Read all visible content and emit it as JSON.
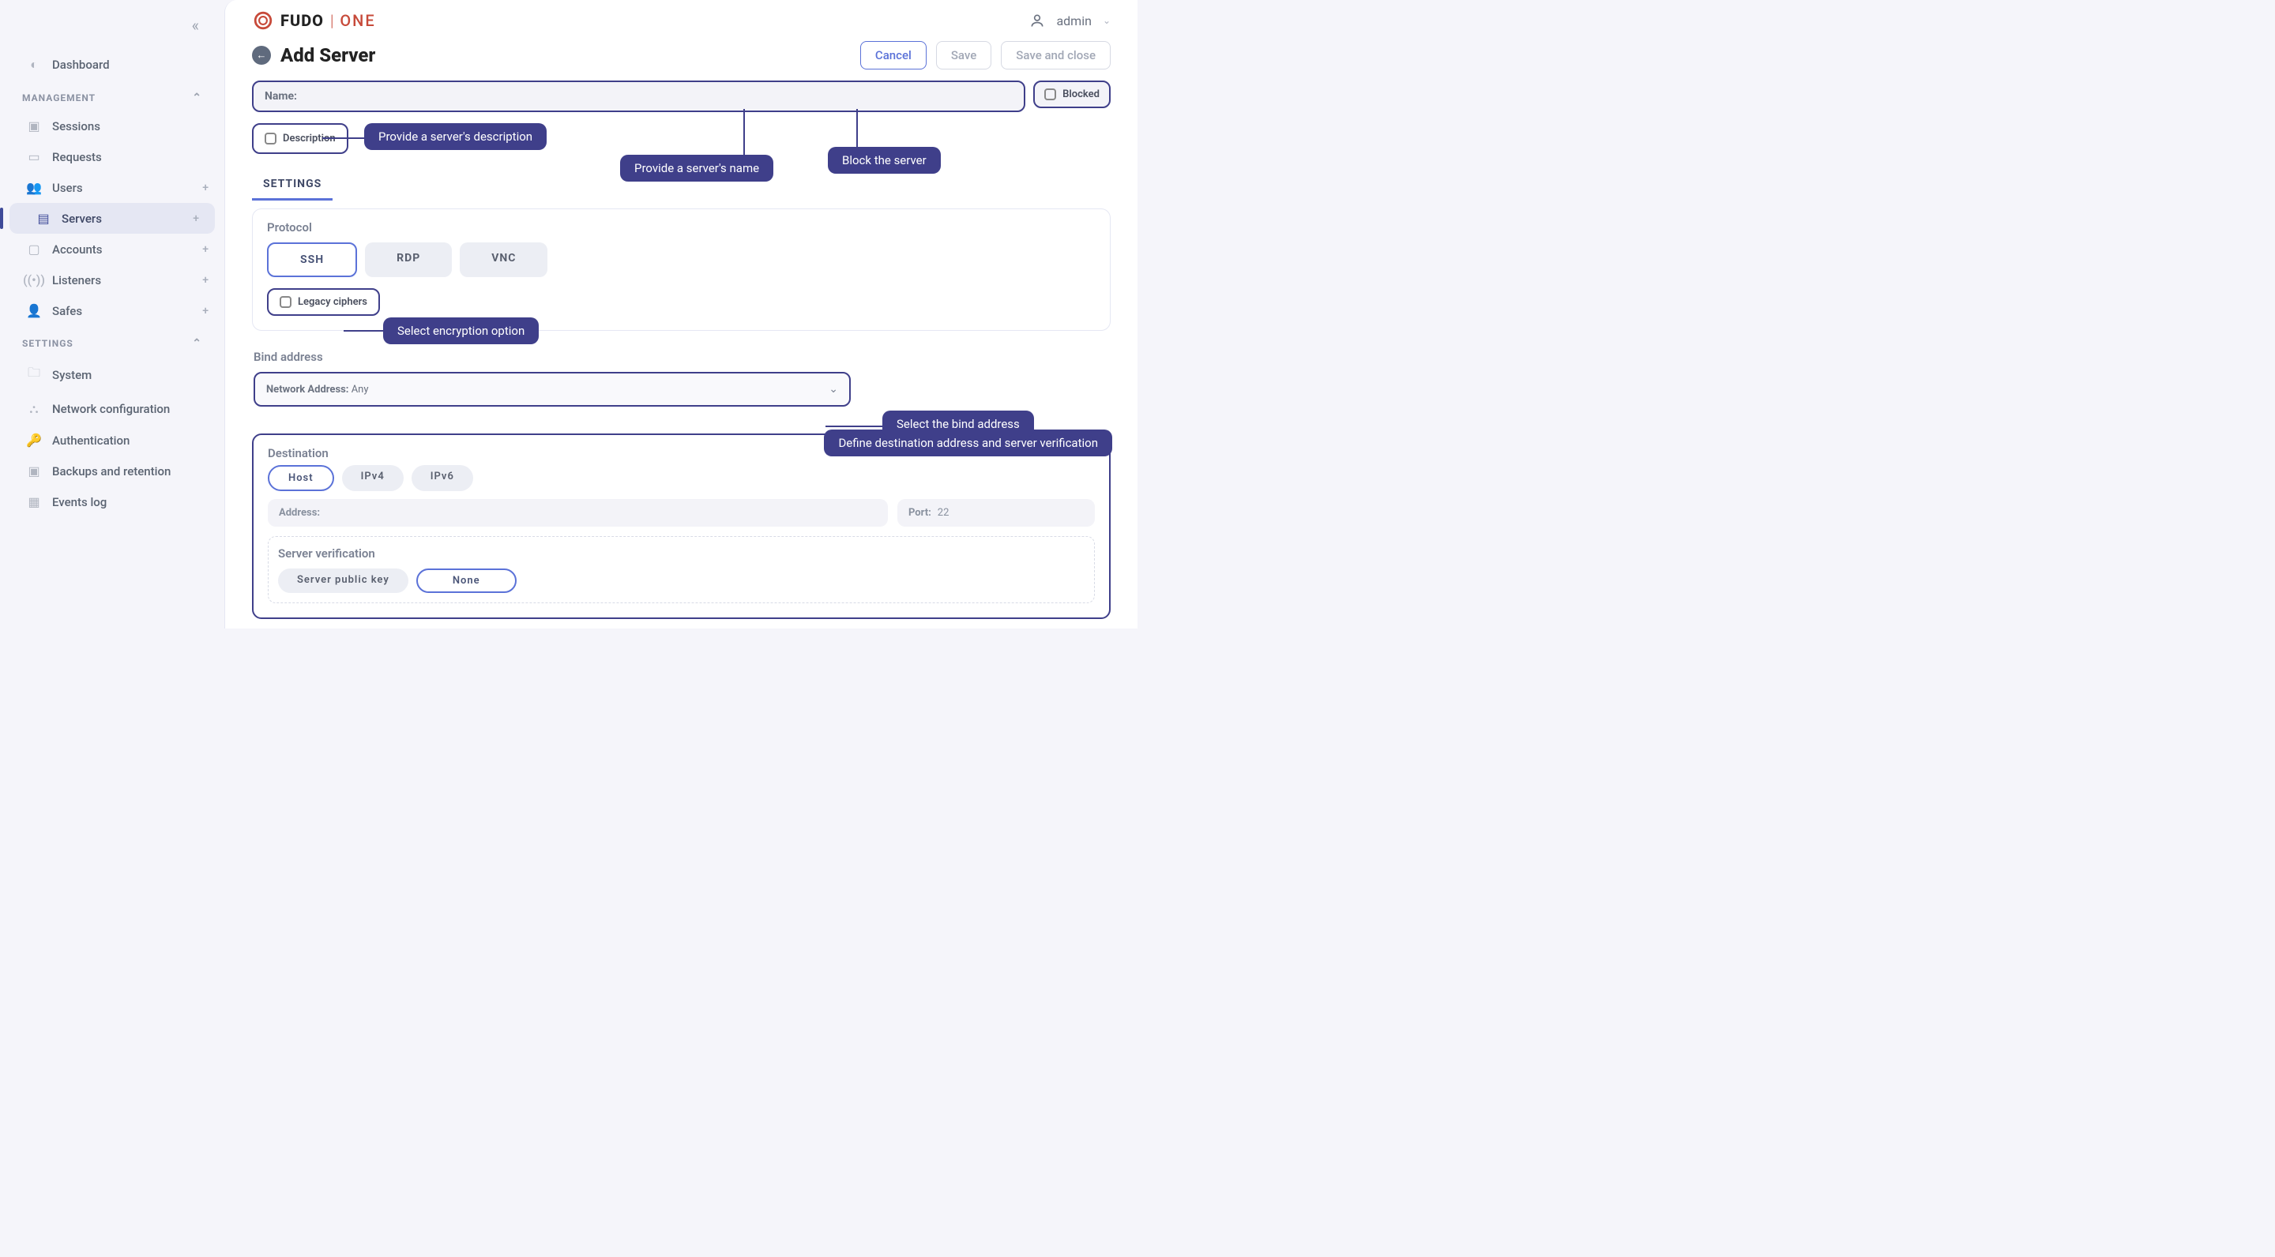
{
  "header": {
    "brand_main": "FUDO",
    "brand_sub": "ONE",
    "user": "admin"
  },
  "page": {
    "title": "Add Server",
    "cancel": "Cancel",
    "save": "Save",
    "save_close": "Save and close"
  },
  "sidebar": {
    "dashboard": "Dashboard",
    "management_label": "MANAGEMENT",
    "settings_label": "SETTINGS",
    "items": [
      {
        "label": "Sessions"
      },
      {
        "label": "Requests"
      },
      {
        "label": "Users"
      },
      {
        "label": "Servers"
      },
      {
        "label": "Accounts"
      },
      {
        "label": "Listeners"
      },
      {
        "label": "Safes"
      }
    ],
    "settings_items": [
      {
        "label": "System"
      },
      {
        "label": "Network configuration"
      },
      {
        "label": "Authentication"
      },
      {
        "label": "Backups and retention"
      },
      {
        "label": "Events log"
      }
    ]
  },
  "form": {
    "name_label": "Name:",
    "blocked_label": "Blocked",
    "description_label": "Description",
    "tab_settings": "SETTINGS",
    "protocol_title": "Protocol",
    "protocols": {
      "ssh": "SSH",
      "rdp": "RDP",
      "vnc": "VNC"
    },
    "legacy_label": "Legacy ciphers",
    "bind_title": "Bind address",
    "bind_label": "Network Address:",
    "bind_value": "Any",
    "dest_title": "Destination",
    "dest_types": {
      "host": "Host",
      "ipv4": "IPv4",
      "ipv6": "IPv6"
    },
    "address_label": "Address:",
    "port_label": "Port:",
    "port_value": "22",
    "verify_title": "Server verification",
    "verify_pubkey": "Server public key",
    "verify_none": "None"
  },
  "callouts": {
    "desc": "Provide a server's description",
    "name": "Provide a server's name",
    "block": "Block the server",
    "encryption": "Select encryption option",
    "bind": "Select the bind address",
    "dest": "Define destination address and server verification"
  }
}
